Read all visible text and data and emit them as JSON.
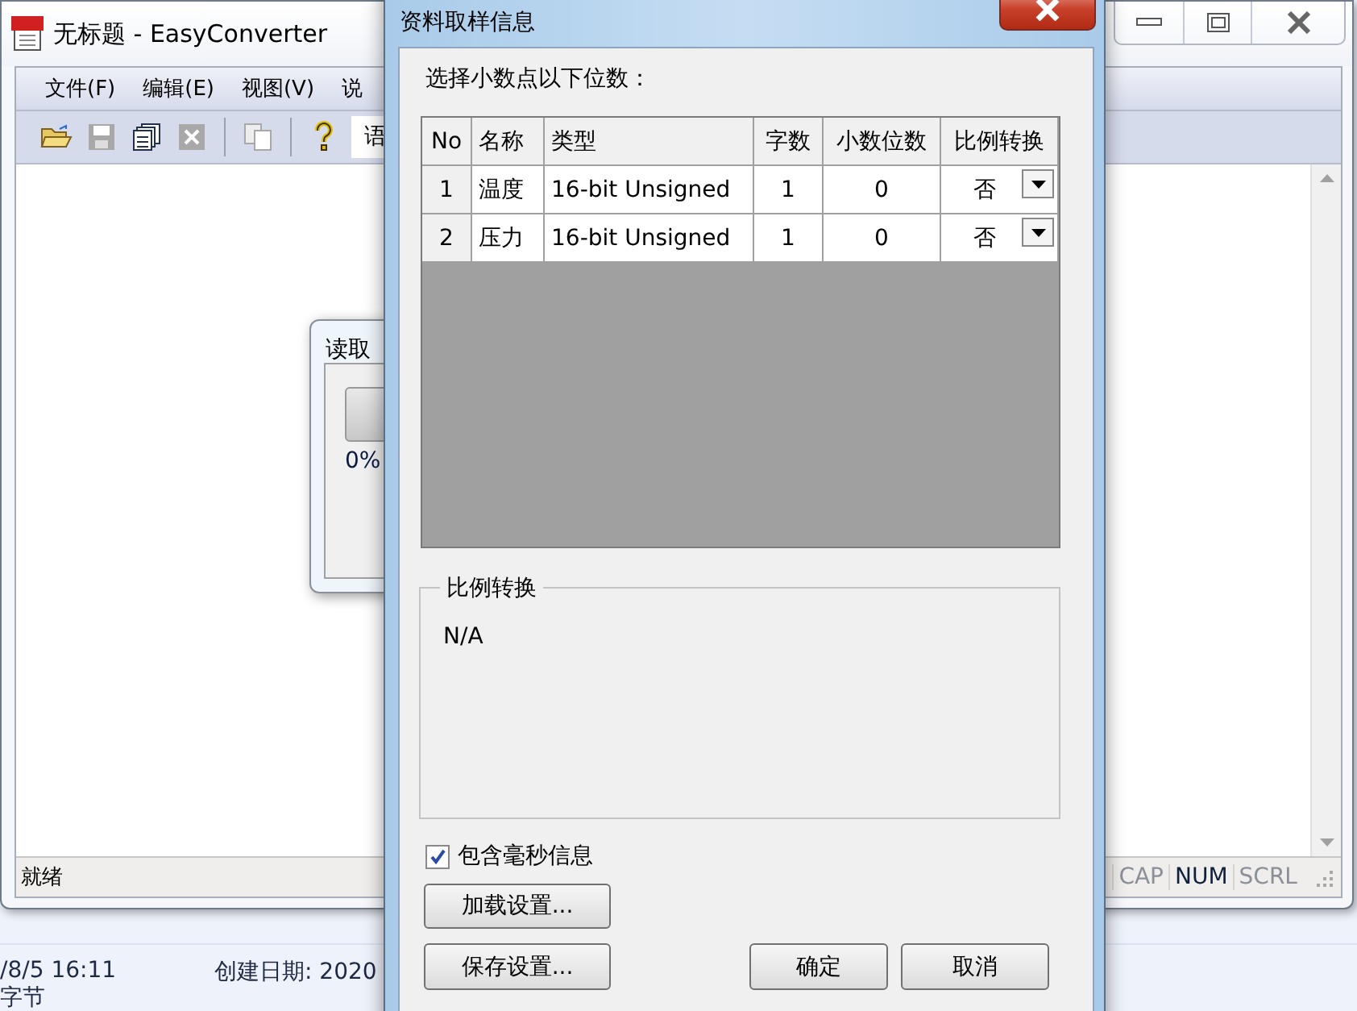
{
  "main_window": {
    "title": "无标题 - EasyConverter",
    "menu": [
      "文件(F)",
      "编辑(E)",
      "视图(V)",
      "说"
    ],
    "toolbar": [
      {
        "kind": "open",
        "disabled": false
      },
      {
        "kind": "save",
        "disabled": true
      },
      {
        "kind": "copies",
        "disabled": false
      },
      {
        "kind": "sheet",
        "disabled": true
      },
      {
        "kind": "separator"
      },
      {
        "kind": "paste",
        "disabled": true
      },
      {
        "kind": "separator"
      },
      {
        "kind": "help",
        "disabled": false
      }
    ],
    "toolbar_field": "语",
    "status_bar": {
      "text": "就绪",
      "indicators": [
        {
          "label": "CAP",
          "on": false
        },
        {
          "label": "NUM",
          "on": true
        },
        {
          "label": "SCRL",
          "on": false
        }
      ]
    }
  },
  "progress_dialog": {
    "title": "读取",
    "level": 0,
    "percent": "0%"
  },
  "dialog": {
    "title": "资料取样信息",
    "prompt": "选择小数点以下位数：",
    "table": {
      "columns": [
        "No",
        "名称",
        "类型",
        "字数",
        "小数位数",
        "比例转换"
      ],
      "rows": [
        {
          "no": "1",
          "name": "温度",
          "type": "16-bit Unsigned",
          "words": "1",
          "decimals": "0",
          "scaling": "否"
        },
        {
          "no": "2",
          "name": "压力",
          "type": "16-bit Unsigned",
          "words": "1",
          "decimals": "0",
          "scaling": "否"
        }
      ]
    },
    "group": {
      "title": "比例转换",
      "text": "N/A"
    },
    "checkbox": {
      "label": "包含毫秒信息",
      "checked": true
    },
    "buttons": [
      "加载设置...",
      "保存设置...",
      "确定",
      "取消"
    ]
  },
  "file_info": [
    "/8/5 16:11",
    "创建日期: 2020",
    "字节"
  ]
}
